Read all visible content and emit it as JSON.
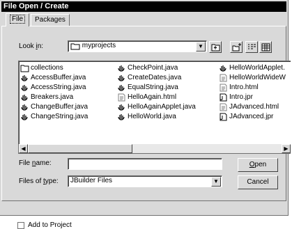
{
  "window": {
    "title": "File Open / Create"
  },
  "tabs": [
    {
      "label": "File"
    },
    {
      "label": "Packages"
    }
  ],
  "look_in": {
    "label_pre": "Look ",
    "label_key": "i",
    "label_post": "n:",
    "value": "myprojects"
  },
  "toolbar": {
    "up": "up-folder-icon",
    "new": "new-folder-icon",
    "list": "list-view-icon",
    "details": "details-view-icon"
  },
  "files": {
    "col1": [
      "collections",
      "AccessBuffer.java",
      "AccessString.java",
      "Breakers.java",
      "ChangeBuffer.java",
      "ChangeString.java"
    ],
    "col2": [
      "CheckPoint.java",
      "CreateDates.java",
      "EqualString.java",
      "HelloAgain.html",
      "HelloAgainApplet.java",
      "HelloWorld.java"
    ],
    "col3": [
      "HelloWorldApplet.",
      "HelloWorldWideW",
      "Intro.html",
      "Intro.jpr",
      "JAdvanced.html",
      "JAdvanced.jpr"
    ]
  },
  "file_name": {
    "label_pre": "File ",
    "label_key": "n",
    "label_post": "ame:",
    "value": ""
  },
  "file_type": {
    "label_pre": "Files of ",
    "label_key": "t",
    "label_post": "ype:",
    "value": "JBuilder Files"
  },
  "buttons": {
    "open_key": "O",
    "open_rest": "pen",
    "cancel": "Cancel"
  },
  "add_to_project": {
    "label": "Add to Project"
  }
}
